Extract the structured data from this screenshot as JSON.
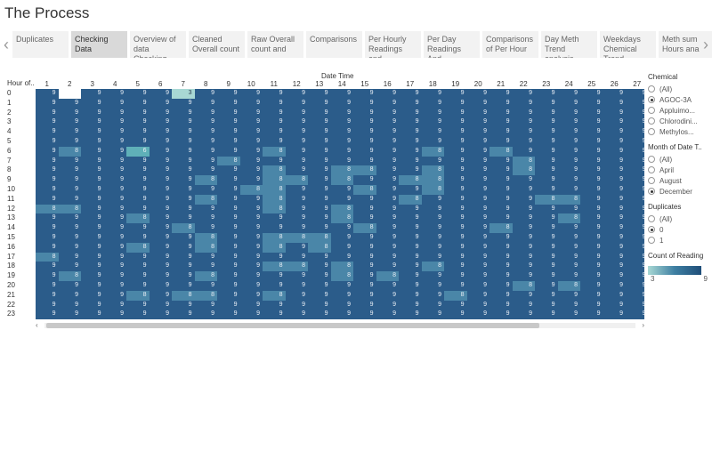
{
  "page": {
    "title": "The Process"
  },
  "tabs": [
    {
      "label": "Duplicates",
      "active": false
    },
    {
      "label": "Checking Data",
      "active": true
    },
    {
      "label": "Overview of data Checking",
      "active": false
    },
    {
      "label": "Cleaned Overall count",
      "active": false
    },
    {
      "label": "Raw Overall count and",
      "active": false
    },
    {
      "label": "Comparisons",
      "active": false
    },
    {
      "label": "Per Hourly Readings and",
      "active": false
    },
    {
      "label": "Per Day Readings And",
      "active": false
    },
    {
      "label": "Comparisons of Per Hour",
      "active": false
    },
    {
      "label": "Day Meth Trend analysis",
      "active": false
    },
    {
      "label": "Weekdays Chemical Trend",
      "active": false
    },
    {
      "label": "Meth sum Hours ana",
      "active": false
    }
  ],
  "tab_nav": {
    "prev": "‹",
    "next": "›"
  },
  "heatmap": {
    "row_header": "Hour of..",
    "column_header": "Date Time",
    "days": [
      "1",
      "2",
      "3",
      "4",
      "5",
      "6",
      "7",
      "8",
      "9",
      "10",
      "11",
      "12",
      "13",
      "14",
      "15",
      "16",
      "17",
      "18",
      "19",
      "20",
      "21",
      "22",
      "23",
      "24",
      "25",
      "26",
      "27"
    ],
    "hours": [
      "0",
      "1",
      "2",
      "3",
      "4",
      "5",
      "6",
      "7",
      "8",
      "9",
      "10",
      "11",
      "12",
      "13",
      "14",
      "15",
      "16",
      "17",
      "18",
      "19",
      "20",
      "21",
      "22",
      "23"
    ],
    "default_value": 9,
    "colors": {
      "9": "#2b5c8a",
      "8": "#4a86a8",
      "6": "#5fb0b8",
      "3": "#a8d8d4"
    },
    "overrides": [
      {
        "hour": 0,
        "day": 2,
        "value": null
      },
      {
        "hour": 0,
        "day": 7,
        "value": 3
      },
      {
        "hour": 6,
        "day": 2,
        "value": 8
      },
      {
        "hour": 6,
        "day": 5,
        "value": 6
      },
      {
        "hour": 6,
        "day": 11,
        "value": 8
      },
      {
        "hour": 6,
        "day": 18,
        "value": 8
      },
      {
        "hour": 6,
        "day": 21,
        "value": 8
      },
      {
        "hour": 7,
        "day": 9,
        "value": 8
      },
      {
        "hour": 7,
        "day": 22,
        "value": 8
      },
      {
        "hour": 8,
        "day": 11,
        "value": 8
      },
      {
        "hour": 8,
        "day": 14,
        "value": 8
      },
      {
        "hour": 8,
        "day": 15,
        "value": 8
      },
      {
        "hour": 8,
        "day": 18,
        "value": 8
      },
      {
        "hour": 8,
        "day": 22,
        "value": 8
      },
      {
        "hour": 9,
        "day": 8,
        "value": 8
      },
      {
        "hour": 9,
        "day": 11,
        "value": 8
      },
      {
        "hour": 9,
        "day": 12,
        "value": 8
      },
      {
        "hour": 9,
        "day": 14,
        "value": 8
      },
      {
        "hour": 9,
        "day": 17,
        "value": 8
      },
      {
        "hour": 9,
        "day": 18,
        "value": 8
      },
      {
        "hour": 10,
        "day": 10,
        "value": 8
      },
      {
        "hour": 10,
        "day": 11,
        "value": 8
      },
      {
        "hour": 10,
        "day": 15,
        "value": 8
      },
      {
        "hour": 10,
        "day": 18,
        "value": 8
      },
      {
        "hour": 11,
        "day": 8,
        "value": 8
      },
      {
        "hour": 11,
        "day": 11,
        "value": 8
      },
      {
        "hour": 11,
        "day": 17,
        "value": 8
      },
      {
        "hour": 11,
        "day": 23,
        "value": 8
      },
      {
        "hour": 11,
        "day": 24,
        "value": 8
      },
      {
        "hour": 12,
        "day": 1,
        "value": 8
      },
      {
        "hour": 12,
        "day": 2,
        "value": 8
      },
      {
        "hour": 12,
        "day": 11,
        "value": 8
      },
      {
        "hour": 12,
        "day": 14,
        "value": 8
      },
      {
        "hour": 13,
        "day": 5,
        "value": 8
      },
      {
        "hour": 13,
        "day": 14,
        "value": 8
      },
      {
        "hour": 13,
        "day": 24,
        "value": 8
      },
      {
        "hour": 14,
        "day": 7,
        "value": 8
      },
      {
        "hour": 14,
        "day": 15,
        "value": 8
      },
      {
        "hour": 14,
        "day": 21,
        "value": 8
      },
      {
        "hour": 15,
        "day": 8,
        "value": 8
      },
      {
        "hour": 15,
        "day": 11,
        "value": 8
      },
      {
        "hour": 15,
        "day": 12,
        "value": 8
      },
      {
        "hour": 15,
        "day": 13,
        "value": 8
      },
      {
        "hour": 16,
        "day": 5,
        "value": 8
      },
      {
        "hour": 16,
        "day": 8,
        "value": 8
      },
      {
        "hour": 16,
        "day": 11,
        "value": 8
      },
      {
        "hour": 16,
        "day": 13,
        "value": 8
      },
      {
        "hour": 17,
        "day": 1,
        "value": 8
      },
      {
        "hour": 18,
        "day": 11,
        "value": 8
      },
      {
        "hour": 18,
        "day": 12,
        "value": 8
      },
      {
        "hour": 18,
        "day": 14,
        "value": 8
      },
      {
        "hour": 18,
        "day": 18,
        "value": 8
      },
      {
        "hour": 19,
        "day": 2,
        "value": 8
      },
      {
        "hour": 19,
        "day": 8,
        "value": 8
      },
      {
        "hour": 19,
        "day": 14,
        "value": 8
      },
      {
        "hour": 19,
        "day": 16,
        "value": 8
      },
      {
        "hour": 20,
        "day": 22,
        "value": 8
      },
      {
        "hour": 20,
        "day": 24,
        "value": 8
      },
      {
        "hour": 21,
        "day": 5,
        "value": 8
      },
      {
        "hour": 21,
        "day": 7,
        "value": 8
      },
      {
        "hour": 21,
        "day": 8,
        "value": 8
      },
      {
        "hour": 21,
        "day": 11,
        "value": 8
      },
      {
        "hour": 21,
        "day": 19,
        "value": 8
      }
    ]
  },
  "filters": {
    "chemical": {
      "title": "Chemical",
      "options": [
        {
          "label": "(All)",
          "selected": false
        },
        {
          "label": "AGOC-3A",
          "selected": true
        },
        {
          "label": "Appluimo...",
          "selected": false
        },
        {
          "label": "Chlorodini...",
          "selected": false
        },
        {
          "label": "Methylos...",
          "selected": false
        }
      ]
    },
    "month": {
      "title": "Month of Date T..",
      "options": [
        {
          "label": "(All)",
          "selected": false
        },
        {
          "label": "April",
          "selected": false
        },
        {
          "label": "August",
          "selected": false
        },
        {
          "label": "December",
          "selected": true
        }
      ]
    },
    "duplicates": {
      "title": "Duplicates",
      "options": [
        {
          "label": "(All)",
          "selected": false
        },
        {
          "label": "0",
          "selected": true
        },
        {
          "label": "1",
          "selected": false
        }
      ]
    }
  },
  "legend": {
    "title": "Count of Reading",
    "min": "3",
    "max": "9"
  },
  "scrollbar": {
    "left": "‹",
    "right": "›"
  }
}
